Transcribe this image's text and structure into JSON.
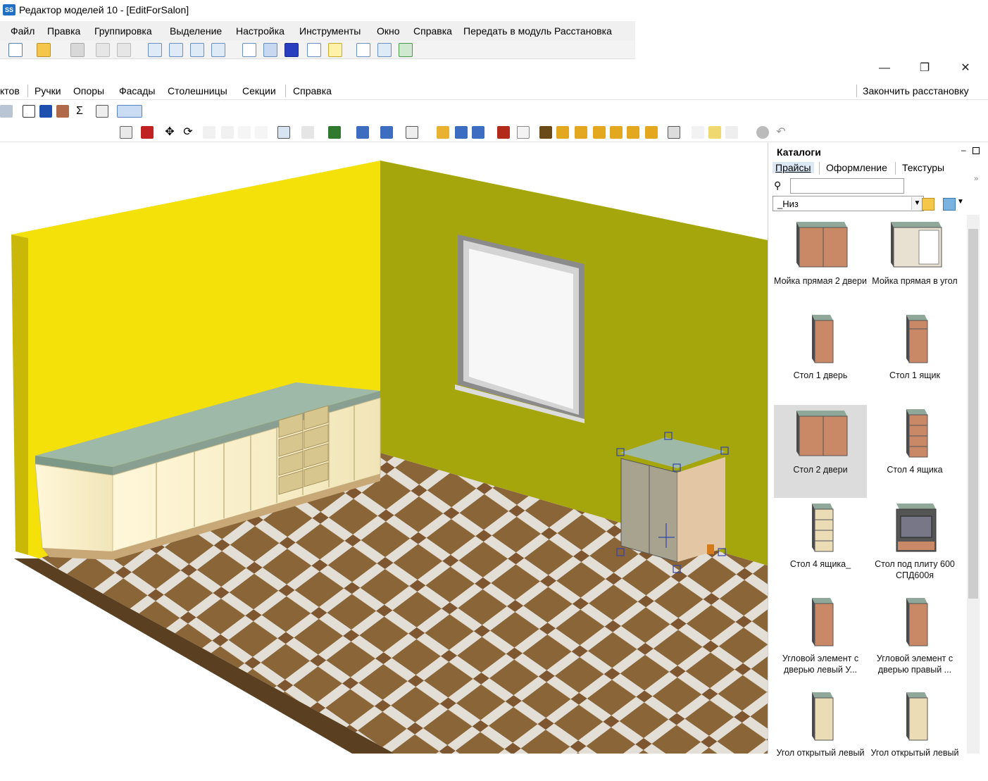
{
  "window": {
    "title": "Редактор моделей 10 - [EditForSalon]"
  },
  "outer_menu": [
    "Файл",
    "Правка",
    "Группировка",
    "Выделение",
    "Настройка",
    "Инструменты",
    "Окно",
    "Справка",
    "Передать в модуль Расстановка"
  ],
  "window_controls": {
    "minimize": "—",
    "restore": "❐",
    "close": "✕"
  },
  "inner_menu": {
    "items": [
      "ктов",
      "Ручки",
      "Опоры",
      "Фасады",
      "Столешницы",
      "Секции",
      "Справка"
    ],
    "finish": "Закончить расстановку"
  },
  "catalog": {
    "title": "Каталоги",
    "tabs": [
      "Прайсы",
      "Оформление",
      "Текстуры"
    ],
    "active_tab": "Прайсы",
    "search": {
      "value": "",
      "placeholder": ""
    },
    "group": "_Низ",
    "items": [
      {
        "label": "Мойка прямая 2 двери",
        "kind": "base2"
      },
      {
        "label": "Мойка прямая в угол",
        "kind": "corner-open"
      },
      {
        "label": "Стол 1 дверь",
        "kind": "base1"
      },
      {
        "label": "Стол 1 ящик",
        "kind": "base1d"
      },
      {
        "label": "Стол 2 двери",
        "kind": "base2",
        "selected": true
      },
      {
        "label": "Стол 4 ящика",
        "kind": "drawers"
      },
      {
        "label": "Стол 4 ящика_",
        "kind": "drawers-light"
      },
      {
        "label": "Стол под плиту 600 СПД600я",
        "kind": "oven"
      },
      {
        "label": "Угловой элемент с дверью левый У...",
        "kind": "angle"
      },
      {
        "label": "Угловой элемент с дверью правый ...",
        "kind": "angle"
      },
      {
        "label": "Угол открытый левый",
        "kind": "open"
      },
      {
        "label": "Угол открытый левый",
        "kind": "open"
      }
    ]
  },
  "colors": {
    "wall_left": "#f5e10a",
    "wall_back": "#a5a50c",
    "floor": "#8a6538",
    "cabinet": "#fbf2cf",
    "countertop": "#9fb9a8"
  }
}
